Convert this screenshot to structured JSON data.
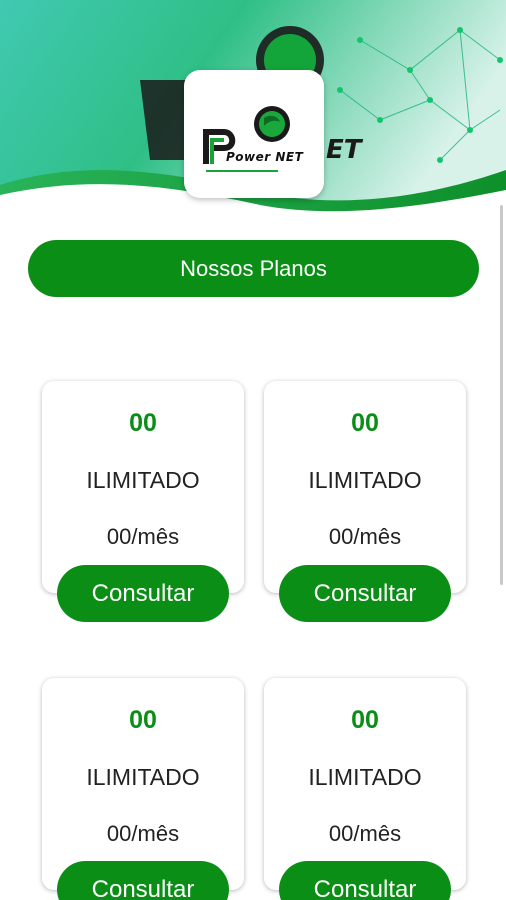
{
  "brand": {
    "logo_text": "Power NET"
  },
  "header": {
    "section_title": "Nossos Planos"
  },
  "plans": [
    {
      "speed": "00",
      "type": "ILIMITADO",
      "price": "00/mês",
      "button_label": "Consultar"
    },
    {
      "speed": "00",
      "type": "ILIMITADO",
      "price": "00/mês",
      "button_label": "Consultar"
    },
    {
      "speed": "00",
      "type": "ILIMITADO",
      "price": "00/mês",
      "button_label": "Consultar"
    },
    {
      "speed": "00",
      "type": "ILIMITADO",
      "price": "00/mês",
      "button_label": "Consultar"
    }
  ],
  "colors": {
    "accent_green": "#0a8e16",
    "header_teal": "#3fc8b0",
    "header_green": "#1faa55"
  }
}
